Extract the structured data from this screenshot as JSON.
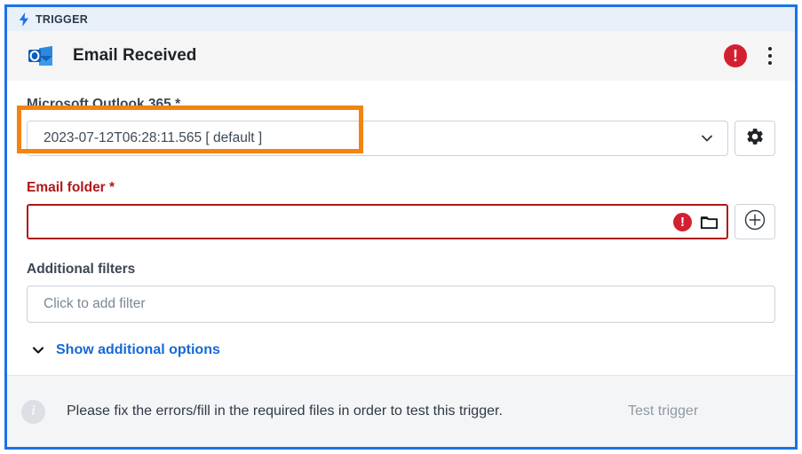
{
  "trigger_bar": {
    "label": "TRIGGER",
    "icon": "lightning-bolt-icon"
  },
  "header": {
    "title": "Email Received",
    "app_icon": "microsoft-outlook-icon",
    "error_badge": "!",
    "menu_icon": "kebab-menu-icon"
  },
  "fields": {
    "connection": {
      "label": "Microsoft Outlook 365 *",
      "value": "2023-07-12T06:28:11.565 [ default ]",
      "dropdown_icon": "chevron-down-icon",
      "settings_icon": "gear-icon",
      "highlighted": true,
      "highlight_color": "#f28411"
    },
    "email_folder": {
      "label": "Email folder *",
      "value": "",
      "error": true,
      "error_badge": "!",
      "error_color": "#b01818",
      "folder_icon": "folder-icon",
      "add_icon": "plus-circle-icon"
    },
    "additional_filters": {
      "label": "Additional filters",
      "placeholder": "Click to add filter",
      "value": ""
    }
  },
  "show_additional_options": {
    "label": "Show additional options",
    "icon": "chevron-down-icon",
    "color": "#1669d6"
  },
  "footer": {
    "info_icon": "info-icon",
    "message": "Please fix the errors/fill in the required files in order to test this trigger.",
    "test_button": "Test trigger",
    "test_button_disabled": true
  },
  "colors": {
    "card_border": "#1a73e8",
    "trigger_bar_bg": "#e9f0fa",
    "title_bar_bg": "#f5f5f5",
    "error_red": "#d32030",
    "highlight_orange": "#f28411",
    "link_blue": "#1669d6"
  }
}
